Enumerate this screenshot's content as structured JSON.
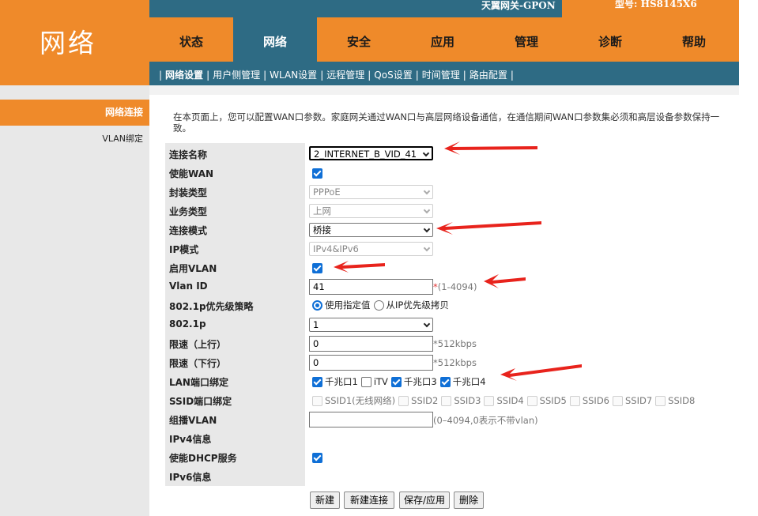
{
  "header": {
    "brand": "天翼网关-GPON",
    "model": "型号: HS8145X6",
    "logo_title": "网络"
  },
  "nav": {
    "tabs": [
      {
        "label": "状态",
        "active": false
      },
      {
        "label": "网络",
        "active": true
      },
      {
        "label": "安全",
        "active": false
      },
      {
        "label": "应用",
        "active": false
      },
      {
        "label": "管理",
        "active": false
      },
      {
        "label": "诊断",
        "active": false
      },
      {
        "label": "帮助",
        "active": false
      }
    ]
  },
  "subnav": {
    "items": [
      "网络设置",
      "用户侧管理",
      "WLAN设置",
      "远程管理",
      "QoS设置",
      "时间管理",
      "路由配置"
    ],
    "active": "网络设置"
  },
  "leftmenu": {
    "items": [
      {
        "label": "网络连接",
        "active": true
      },
      {
        "label": "VLAN绑定",
        "active": false
      }
    ]
  },
  "intro": "在本页面上，您可以配置WAN口参数。家庭网关通过WAN口与高层网络设备通信，在通信期间WAN口参数集必须和高层设备参数保持一致。",
  "form": {
    "labels": {
      "conn_name": "连接名称",
      "enable_wan": "使能WAN",
      "encap": "封装类型",
      "service": "业务类型",
      "conn_mode": "连接模式",
      "ip_mode": "IP模式",
      "enable_vlan": "启用VLAN",
      "vlan_id": "Vlan ID",
      "prio_policy": "802.1p优先级策略",
      "p8021": "802.1p",
      "rate_up": "限速（上行）",
      "rate_down": "限速（下行）",
      "lan_bind": "LAN端口绑定",
      "ssid_bind": "SSID端口绑定",
      "mcast_vlan": "组播VLAN",
      "ipv4_info": "IPv4信息",
      "enable_dhcp": "使能DHCP服务",
      "ipv6_info": "IPv6信息"
    },
    "conn_name": "2_INTERNET_B_VID_41",
    "enable_wan": true,
    "encap": "PPPoE",
    "service": "上网",
    "conn_mode": "桥接",
    "ip_mode": "IPv4&IPv6",
    "enable_vlan": true,
    "vlan_id": "41",
    "vlan_id_hint": "(1-4094)",
    "vlan_id_star": "*",
    "prio_options": [
      "使用指定值",
      "从IP优先级拷贝"
    ],
    "prio_selected": "使用指定值",
    "p8021": "1",
    "rate_up": "0",
    "rate_down": "0",
    "rate_hint": "*512kbps",
    "lan_ports": [
      {
        "label": "千兆口1",
        "checked": true
      },
      {
        "label": "iTV",
        "checked": false
      },
      {
        "label": "千兆口3",
        "checked": true
      },
      {
        "label": "千兆口4",
        "checked": true
      }
    ],
    "ssid_ports": [
      "SSID1(无线网络)",
      "SSID2",
      "SSID3",
      "SSID4",
      "SSID5",
      "SSID6",
      "SSID7",
      "SSID8"
    ],
    "mcast_vlan": "",
    "mcast_hint": "(0–4094,0表示不带vlan)",
    "enable_dhcp": true
  },
  "buttons": {
    "new": "新建",
    "new_conn": "新建连接",
    "save": "保存/应用",
    "delete": "删除"
  },
  "colors": {
    "orange": "#ef8a2a",
    "teal": "#2e6b84",
    "annotation_arrow": "#e8231c",
    "checkbox_blue": "#0f6fd6"
  }
}
